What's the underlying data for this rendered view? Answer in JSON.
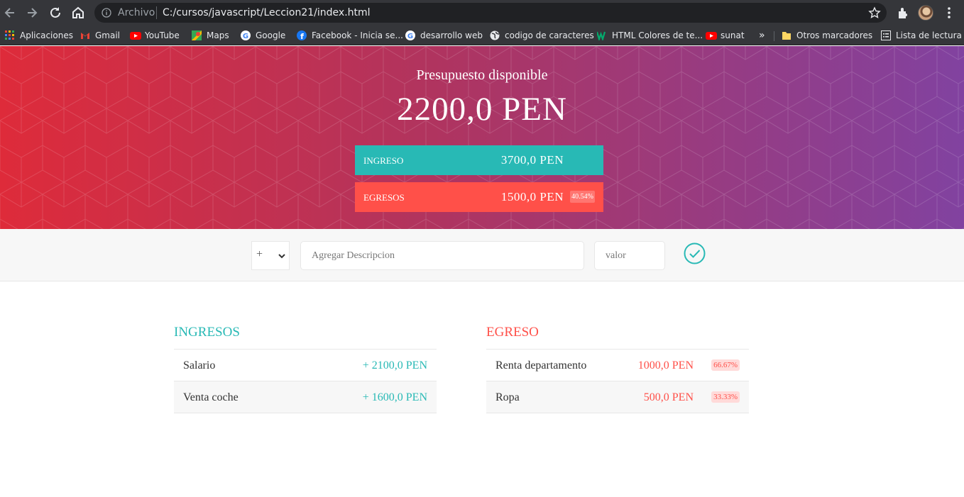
{
  "browser": {
    "archivo_label": "Archivo",
    "url": "C:/cursos/javascript/Leccion21/index.html"
  },
  "bookmarks": {
    "items": [
      {
        "label": "Aplicaciones",
        "icon": "apps-grid-icon"
      },
      {
        "label": "Gmail",
        "icon": "gmail-icon"
      },
      {
        "label": "YouTube",
        "icon": "youtube-icon"
      },
      {
        "label": "Maps",
        "icon": "maps-icon"
      },
      {
        "label": "Google",
        "icon": "google-icon"
      },
      {
        "label": "Facebook - Inicia se...",
        "icon": "facebook-icon"
      },
      {
        "label": "desarrollo web",
        "icon": "google-icon"
      },
      {
        "label": "codigo de caracteres",
        "icon": "globe-icon"
      },
      {
        "label": "HTML Colores de te...",
        "icon": "w3-icon"
      },
      {
        "label": "sunat",
        "icon": "youtube-icon"
      }
    ],
    "overflow": "»",
    "other": "Otros marcadores",
    "reading_list": "Lista de lectura"
  },
  "header": {
    "title": "Presupuesto disponible",
    "total": "2200,0 PEN",
    "income_label": "INGRESO",
    "income_value": "3700,0 PEN",
    "expense_label": "EGRESOS",
    "expense_value": "1500,0 PEN",
    "expense_percent": "40.54%"
  },
  "add_form": {
    "type_selected": "+",
    "description_placeholder": "Agregar Descripcion",
    "value_placeholder": "valor"
  },
  "income": {
    "title": "INGRESOS",
    "items": [
      {
        "description": "Salario",
        "value": "+ 2100,0 PEN"
      },
      {
        "description": "Venta coche",
        "value": "+ 1600,0 PEN"
      }
    ]
  },
  "expenses": {
    "title": "EGRESO",
    "items": [
      {
        "description": "Renta departamento",
        "value": "1000,0 PEN",
        "percent": "66.67%"
      },
      {
        "description": "Ropa",
        "value": "500,0 PEN",
        "percent": "33.33%"
      }
    ]
  },
  "colors": {
    "income": "#28b9b5",
    "expense": "#ff5049",
    "gradient_start": "#de2b3a",
    "gradient_end": "#8142a0"
  }
}
